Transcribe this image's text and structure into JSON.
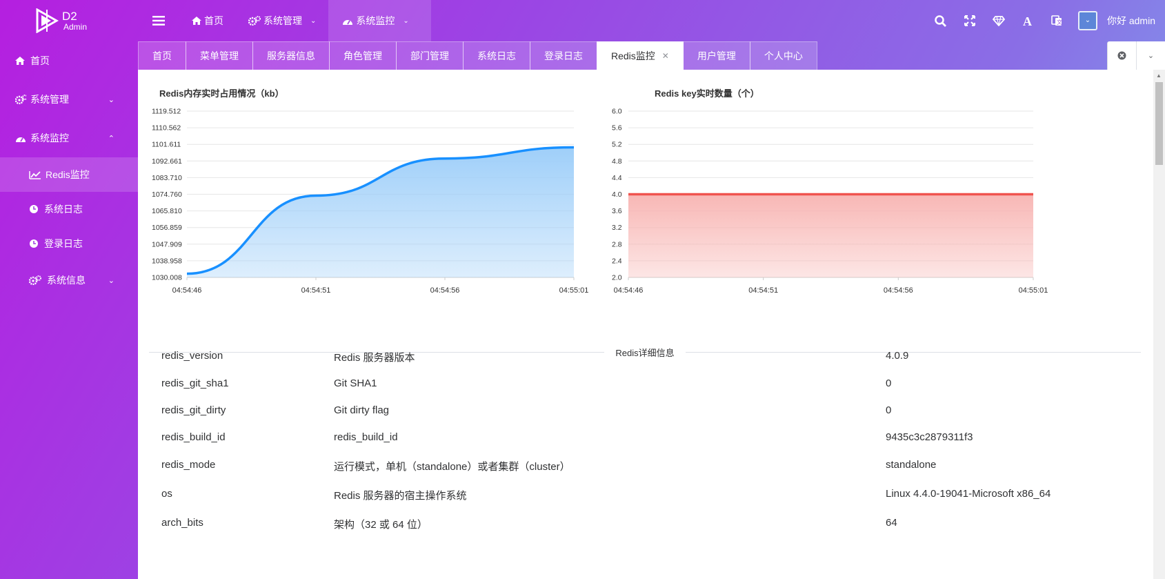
{
  "brand": {
    "name": "D2",
    "sub": "Admin"
  },
  "header": {
    "nav": [
      {
        "label": "首页",
        "icon": "home-icon"
      },
      {
        "label": "系统管理",
        "icon": "gears-icon"
      },
      {
        "label": "系统监控",
        "icon": "dashboard-icon"
      }
    ],
    "greeting": "你好 admin",
    "icons": [
      "search-icon",
      "fullscreen-icon",
      "diamond-icon",
      "font-size-icon",
      "translate-icon",
      "theme-icon"
    ]
  },
  "sidebar": {
    "items": [
      {
        "label": "首页",
        "icon": "home-icon"
      },
      {
        "label": "系统管理",
        "icon": "gears-icon",
        "expanded": false
      },
      {
        "label": "系统监控",
        "icon": "dashboard-icon",
        "expanded": true
      },
      {
        "label": "Redis监控",
        "icon": "line-chart-icon",
        "active": true
      },
      {
        "label": "系统日志",
        "icon": "clock-icon"
      },
      {
        "label": "登录日志",
        "icon": "clock-icon"
      },
      {
        "label": "系统信息",
        "icon": "gears-icon",
        "expanded": false
      }
    ]
  },
  "tabs": [
    "首页",
    "菜单管理",
    "服务器信息",
    "角色管理",
    "部门管理",
    "系统日志",
    "登录日志",
    "Redis监控",
    "用户管理",
    "个人中心"
  ],
  "active_tab": "Redis监控",
  "chart_data": [
    {
      "type": "area",
      "title": "Redis内存实时占用情况（kb）",
      "x": [
        "04:54:46",
        "04:54:51",
        "04:54:56",
        "04:55:01"
      ],
      "values": [
        1032.0,
        1074.0,
        1094.0,
        1100.0
      ],
      "y_ticks": [
        "1030.008",
        "1038.958",
        "1047.909",
        "1056.859",
        "1065.810",
        "1074.760",
        "1083.710",
        "1092.661",
        "1101.611",
        "1110.562",
        "1119.512"
      ],
      "ylim": [
        1030.008,
        1119.512
      ],
      "color": "#1890ff",
      "fill": "#9fcff9"
    },
    {
      "type": "area",
      "title": "Redis key实时数量（个）",
      "x": [
        "04:54:46",
        "04:54:51",
        "04:54:56",
        "04:55:01"
      ],
      "values": [
        4,
        4,
        4,
        4
      ],
      "y_ticks": [
        "2.0",
        "2.4",
        "2.8",
        "3.2",
        "3.6",
        "4.0",
        "4.4",
        "4.8",
        "5.2",
        "5.6",
        "6.0"
      ],
      "ylim": [
        2.0,
        6.0
      ],
      "color": "#f0544f",
      "fill": "#f8b7b5"
    }
  ],
  "details": {
    "title": "Redis详细信息",
    "rows": [
      {
        "key": "redis_version",
        "desc": "Redis 服务器版本",
        "value": "4.0.9"
      },
      {
        "key": "redis_git_sha1",
        "desc": "Git SHA1",
        "value": "0"
      },
      {
        "key": "redis_git_dirty",
        "desc": "Git dirty flag",
        "value": "0"
      },
      {
        "key": "redis_build_id",
        "desc": "redis_build_id",
        "value": "9435c3c2879311f3"
      },
      {
        "key": "redis_mode",
        "desc": "运行模式，单机（standalone）或者集群（cluster）",
        "value": "standalone"
      },
      {
        "key": "os",
        "desc": "Redis 服务器的宿主操作系统",
        "value": "Linux 4.4.0-19041-Microsoft x86_64"
      },
      {
        "key": "arch_bits",
        "desc": "架构（32 或 64 位）",
        "value": "64"
      }
    ]
  }
}
